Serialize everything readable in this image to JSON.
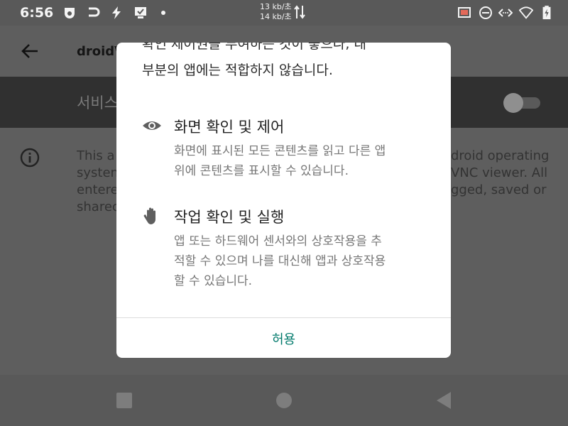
{
  "status_bar": {
    "time": "6:56",
    "speed_up": "13 kb/초",
    "speed_down": "14 kb/초"
  },
  "app": {
    "title": "droidV",
    "service_label": "서비스",
    "description_left": [
      "This a",
      "systen",
      "entere",
      "sharec"
    ],
    "description_right": [
      "droid operating",
      "VNC viewer. All",
      "gged, saved or",
      ""
    ]
  },
  "dialog": {
    "clipped_line": "확인 제어권을 부여하는 것이 좋으나, 대",
    "lead_line": "부분의 앱에는 적합하지 않습니다.",
    "permissions": [
      {
        "icon": "eye-icon",
        "title": "화면 확인 및 제어",
        "description": [
          "화면에 표시된 모든 콘텐츠를 읽고 다른 앱",
          "위에 콘텐츠를 표시할 수 있습니다."
        ]
      },
      {
        "icon": "hand-icon",
        "title": "작업 확인 및 실행",
        "description": [
          "앱 또는 하드웨어 센서와의 상호작용을 추",
          "적할 수 있으며 나를 대신해 앱과 상호작용",
          "할 수 있습니다."
        ]
      }
    ],
    "allow_label": "허용"
  },
  "colors": {
    "accent": "#00796b",
    "dialog_bg": "#ffffff",
    "scrim": "#5e5e5e"
  }
}
